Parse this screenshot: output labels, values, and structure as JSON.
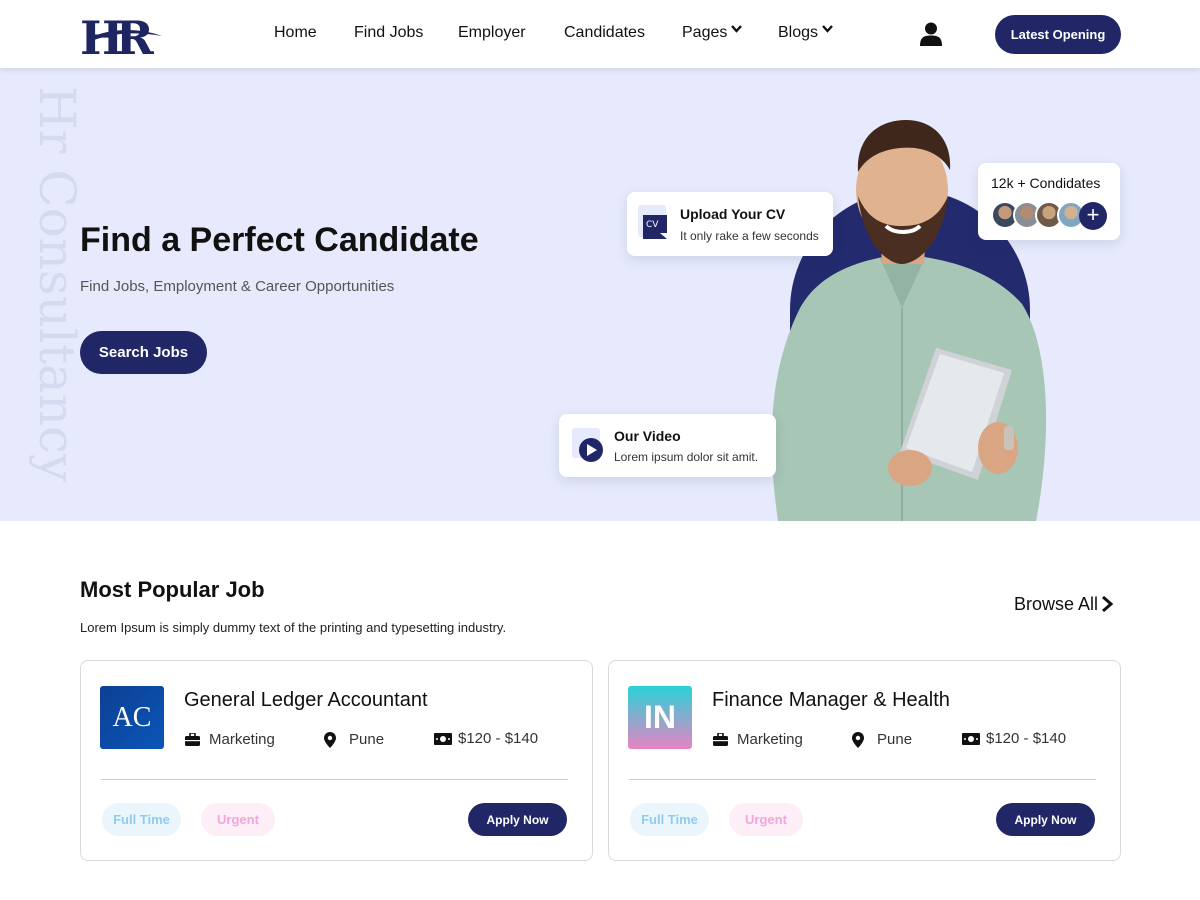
{
  "header": {
    "logo_text": "HR",
    "nav": [
      {
        "label": "Home"
      },
      {
        "label": "Find Jobs"
      },
      {
        "label": "Employer"
      },
      {
        "label": "Candidates"
      },
      {
        "label": "Pages",
        "dropdown": true
      },
      {
        "label": "Blogs",
        "dropdown": true
      }
    ],
    "user_icon": "user-icon",
    "cta_label": "Latest Opening"
  },
  "hero": {
    "watermark": "Hr Consultancy",
    "title": "Find a Perfect Candidate",
    "subtitle": "Find Jobs, Employment & Career Opportunities",
    "search_label": "Search Jobs",
    "upload_card": {
      "icon_text": "CV",
      "title": "Upload Your CV",
      "subtitle": "It only rake a few seconds"
    },
    "video_card": {
      "title": "Our Video",
      "subtitle": "Lorem ipsum dolor sit amit."
    },
    "candidates_card": {
      "title": "12k + Condidates",
      "plus": "+"
    }
  },
  "popular": {
    "title": "Most Popular Job",
    "subtitle": "Lorem Ipsum is simply dummy text of the printing and typesetting industry.",
    "browse_label": "Browse All",
    "jobs": [
      {
        "logo_text": "AC",
        "title": "General Ledger Accountant",
        "category": "Marketing",
        "location": "Pune",
        "salary": "$120 - $140",
        "tag_type": "Full Time",
        "tag_priority": "Urgent",
        "apply_label": "Apply Now"
      },
      {
        "logo_text": "IN",
        "title": "Finance Manager & Health",
        "category": "Marketing",
        "location": "Pune",
        "salary": "$120 - $140",
        "tag_type": "Full Time",
        "tag_priority": "Urgent",
        "apply_label": "Apply Now"
      }
    ]
  },
  "colors": {
    "primary": "#212766",
    "hero_bg": "#e7eafc",
    "tag_full": "#8fcdf0",
    "tag_urgent": "#f3a6da"
  }
}
